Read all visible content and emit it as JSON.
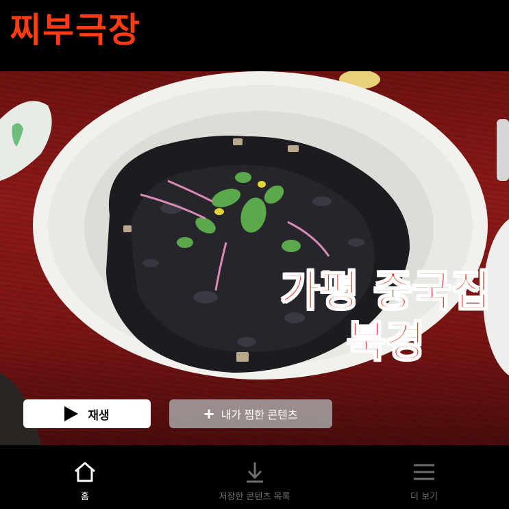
{
  "header": {
    "logo_text": "찌부극장"
  },
  "hero": {
    "overlay_title_line1": "가평 중국집",
    "overlay_title_line2": "북경",
    "play_label": "재생",
    "mylist_label": "내가 찜한 콘텐츠"
  },
  "bottom_nav": {
    "items": [
      {
        "label": "홈",
        "icon": "home-icon",
        "active": true
      },
      {
        "label": "저장한 콘텐츠 목록",
        "icon": "download-icon",
        "active": false
      },
      {
        "label": "더 보기",
        "icon": "menu-icon",
        "active": false
      }
    ]
  },
  "colors": {
    "brand": "#ff3d12",
    "title_fill": "#e8321c",
    "background": "#000000"
  }
}
